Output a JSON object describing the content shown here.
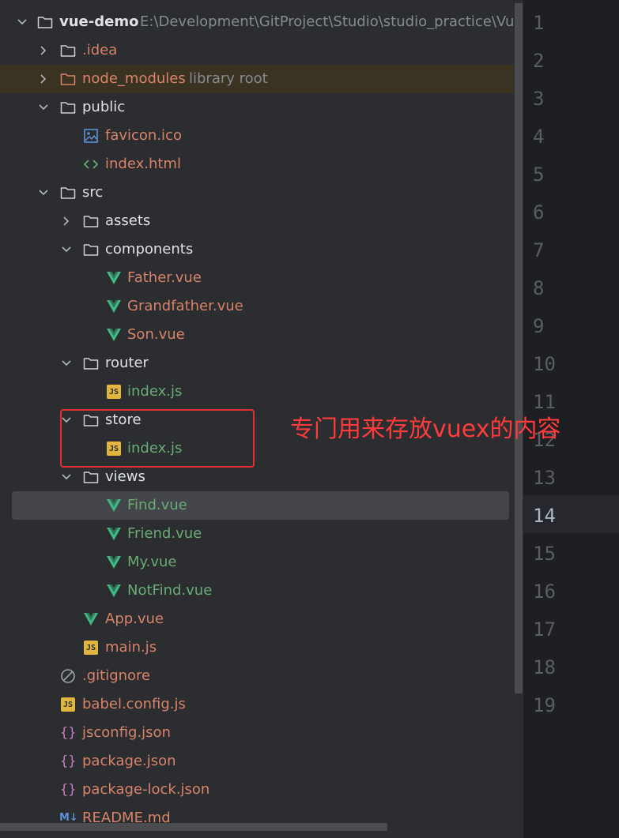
{
  "project": {
    "name": "vue-demo",
    "path": "E:\\Development\\GitProject\\Studio\\studio_practice\\Vue_p"
  },
  "tree": {
    "idea": ".idea",
    "node_modules": "node_modules",
    "node_modules_hint": "library root",
    "public": "public",
    "favicon": "favicon.ico",
    "index_html": "index.html",
    "src": "src",
    "assets": "assets",
    "components": "components",
    "father": "Father.vue",
    "grandfather": "Grandfather.vue",
    "son": "Son.vue",
    "router": "router",
    "router_index": "index.js",
    "store": "store",
    "store_index": "index.js",
    "views": "views",
    "find": "Find.vue",
    "friend": "Friend.vue",
    "my": "My.vue",
    "notfind": "NotFind.vue",
    "app": "App.vue",
    "main": "main.js",
    "gitignore": ".gitignore",
    "babel": "babel.config.js",
    "jsconfig": "jsconfig.json",
    "package": "package.json",
    "package_lock": "package-lock.json",
    "readme": "README.md"
  },
  "icons": {
    "js_badge": "JS",
    "md_badge": "M↓",
    "braces": "{}"
  },
  "line_numbers": [
    "1",
    "2",
    "3",
    "4",
    "5",
    "6",
    "7",
    "8",
    "9",
    "10",
    "11",
    "12",
    "13",
    "14",
    "15",
    "16",
    "17",
    "18",
    "19"
  ],
  "current_line": "14",
  "annotation": "专门用来存放vuex的内容",
  "colors": {
    "background": "#2b2d30",
    "gutter": "#1e1f22",
    "vue_logo": "#41b883",
    "annotation_red": "#ff3b3b",
    "js_badge": "#e2b63e",
    "selection": "#43454a",
    "excluded_highlight": "#3a3322"
  }
}
